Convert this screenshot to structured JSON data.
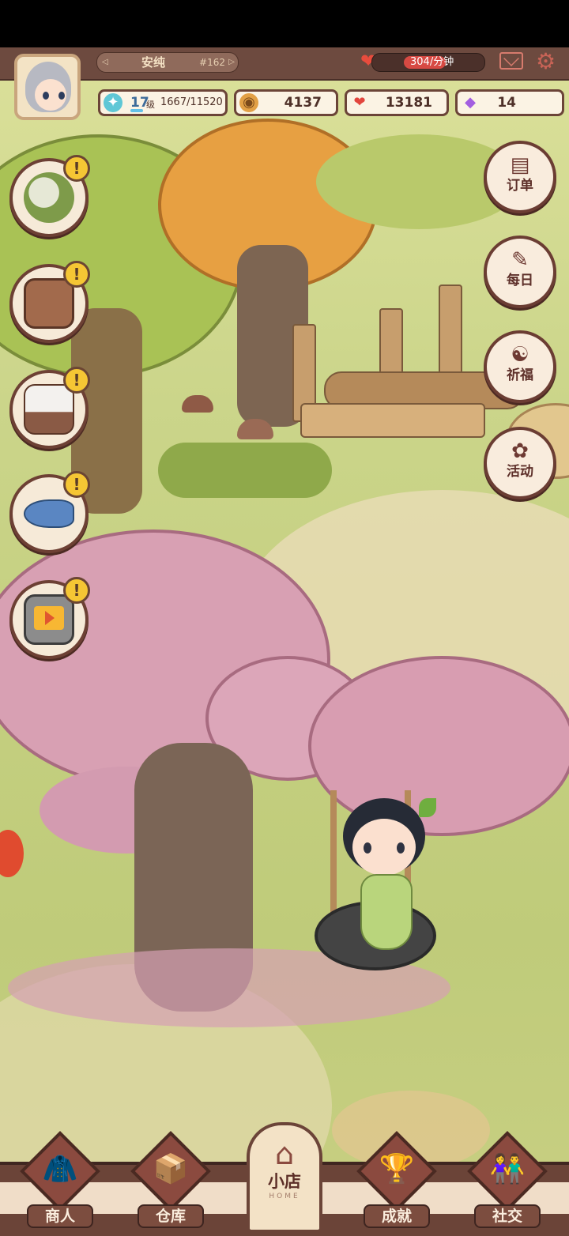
{
  "player": {
    "name": "安纯",
    "id": "#162",
    "level": "17",
    "level_unit": "级",
    "xp": "1667/11520",
    "xp_fraction": 0.145,
    "heart_rate": "304/分钟",
    "heart_rate_fill": 0.55
  },
  "resources": {
    "coins": "4137",
    "hearts": "13181",
    "gems": "14"
  },
  "quest_items": [
    {
      "icon": "cauliflower-icon"
    },
    {
      "icon": "cabinet-icon"
    },
    {
      "icon": "bed-icon"
    },
    {
      "icon": "fish-icon"
    },
    {
      "icon": "tv-icon"
    }
  ],
  "alert_symbol": "!",
  "right_menu": [
    {
      "label": "订单",
      "icon": "order-icon"
    },
    {
      "label": "每日",
      "icon": "daily-icon"
    },
    {
      "label": "祈福",
      "icon": "pray-icon"
    },
    {
      "label": "活动",
      "icon": "event-icon"
    }
  ],
  "bottom_nav": {
    "merchant": "商人",
    "warehouse": "仓库",
    "shop": "小店",
    "shop_sub": "HOME",
    "achievements": "成就",
    "social": "社交"
  },
  "colors": {
    "frame_brown": "#6d4a3f",
    "button_cream": "#f6ead8",
    "alert_yellow": "#f5c634",
    "sakura_pink": "#d8a0b3",
    "grass_green": "#c4cf7f"
  }
}
